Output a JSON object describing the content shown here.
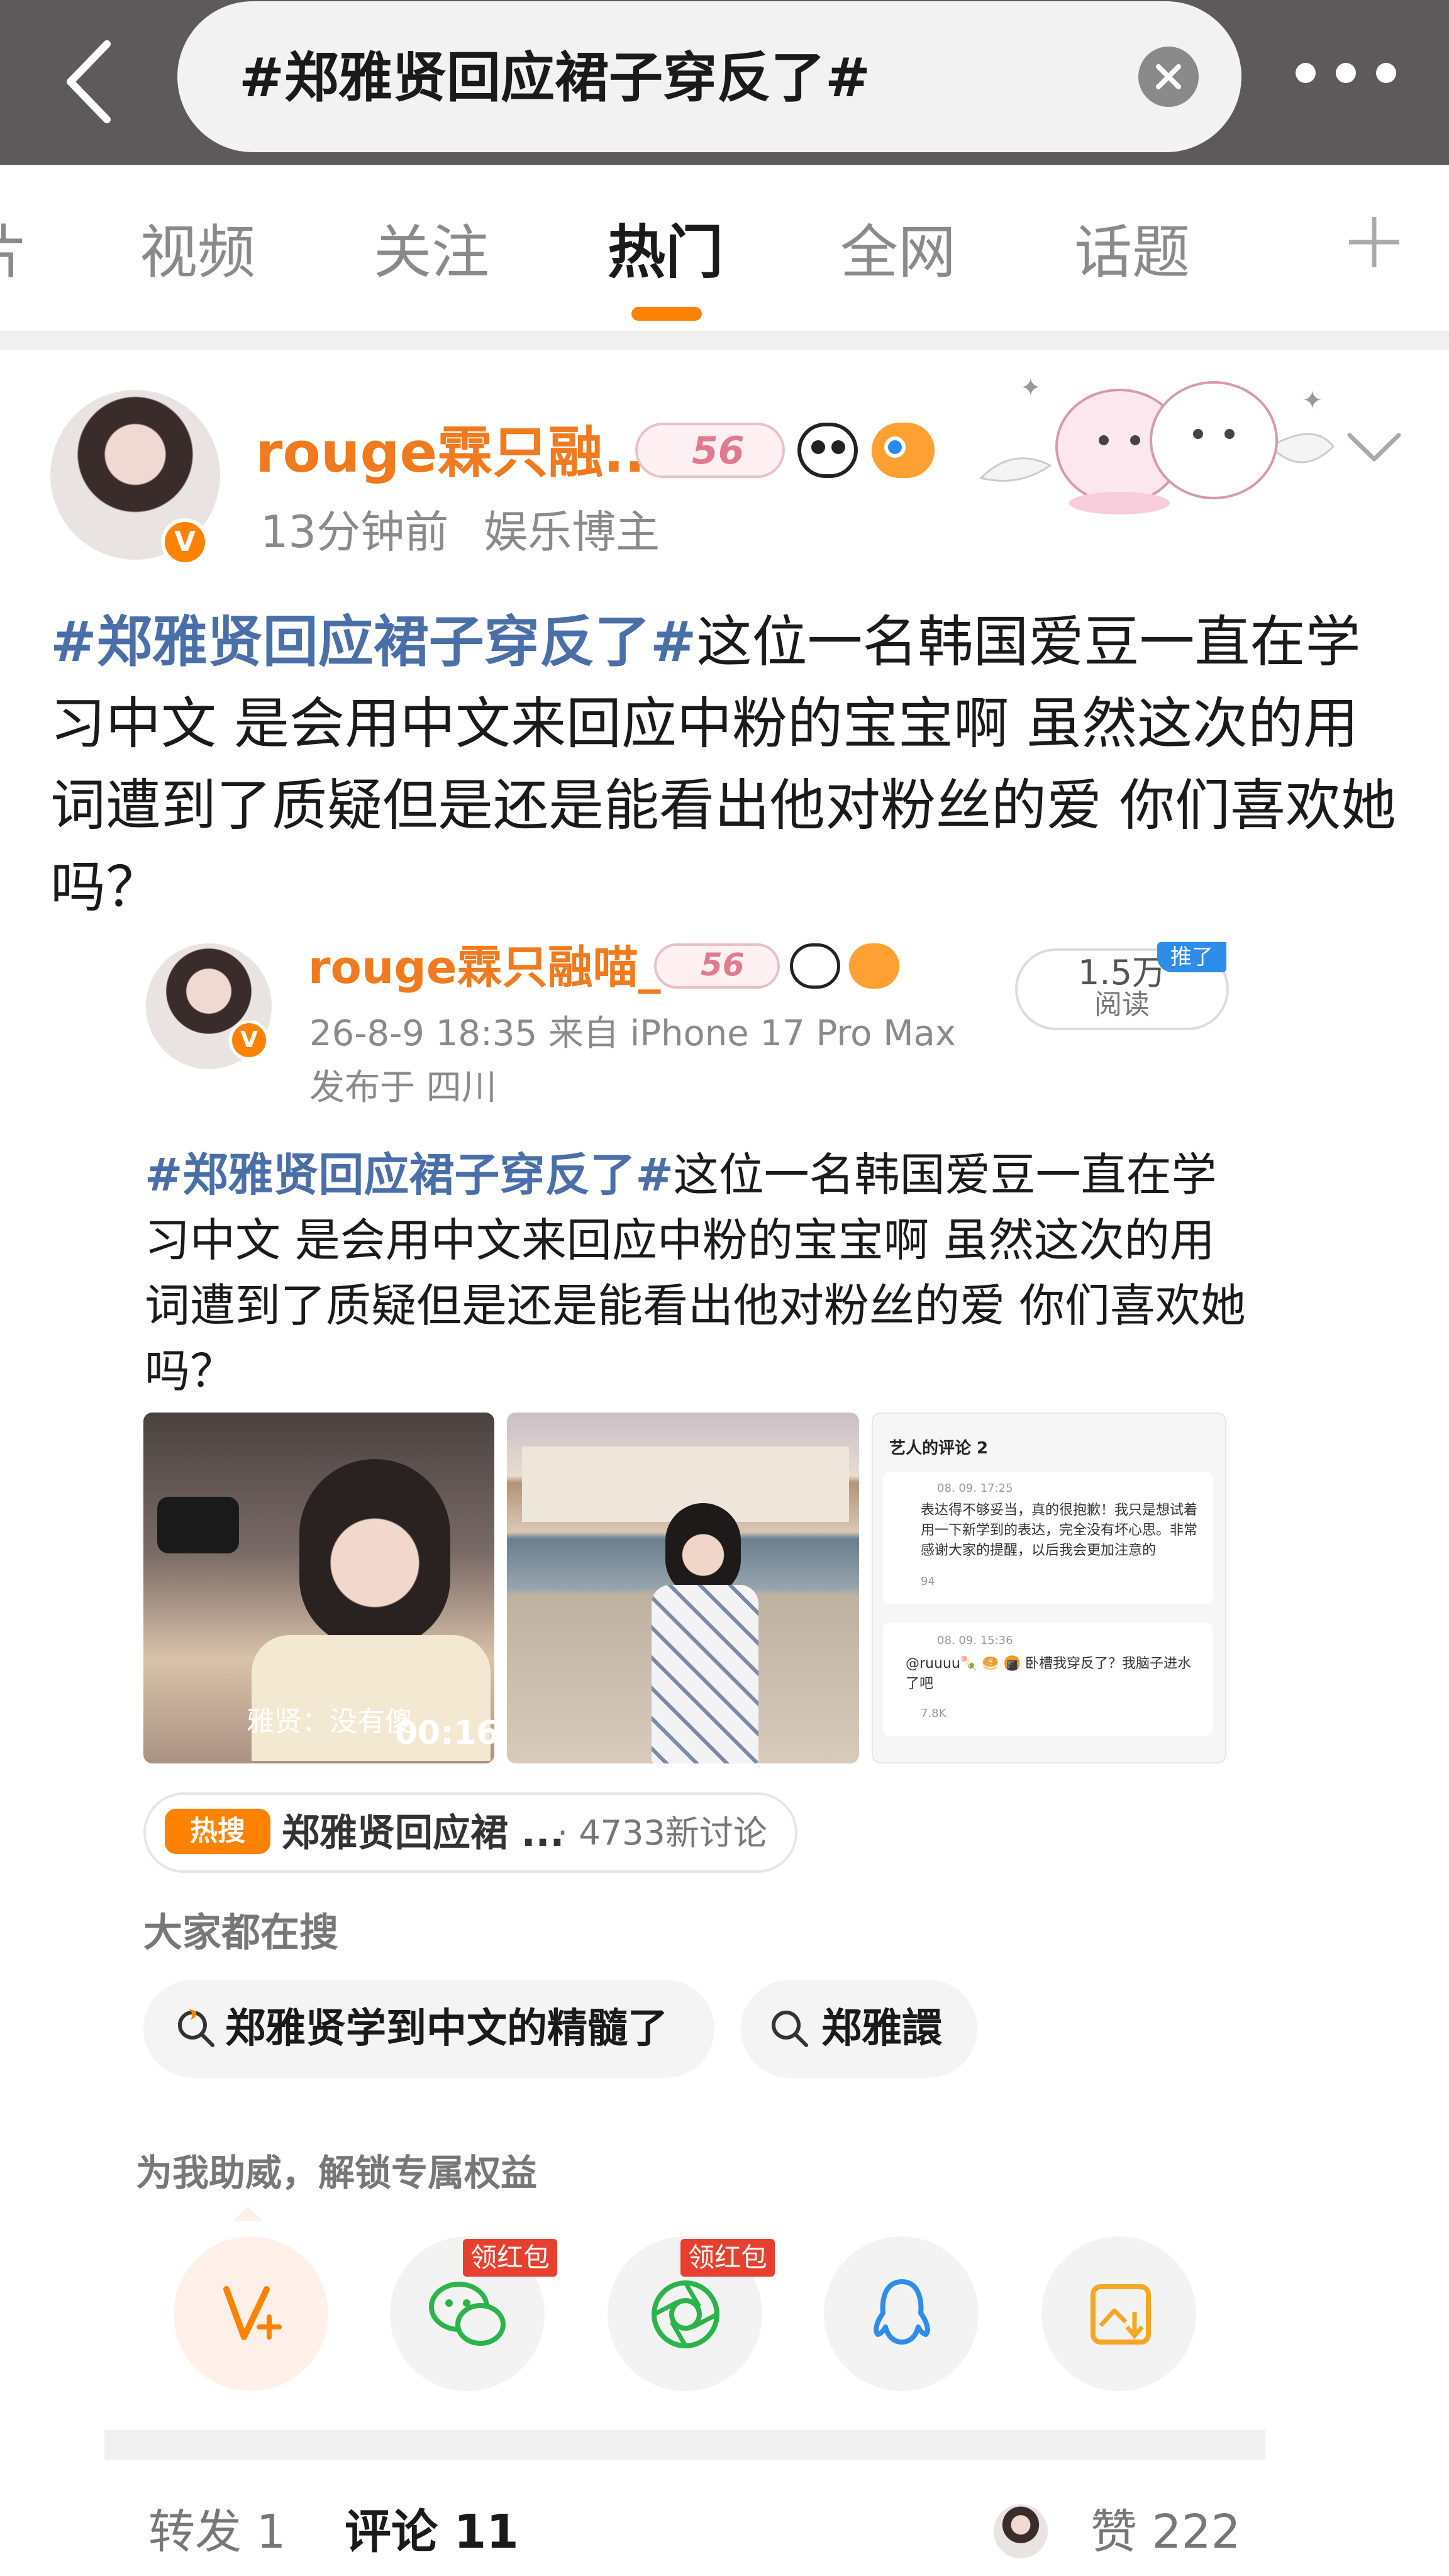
{
  "search": {
    "query": "#郑雅贤回应裙子穿反了#"
  },
  "tabs": [
    {
      "label": "片"
    },
    {
      "label": "视频"
    },
    {
      "label": "关注"
    },
    {
      "label": "热门",
      "active": true
    },
    {
      "label": "全网"
    },
    {
      "label": "话题"
    }
  ],
  "post": {
    "author": "rouge霖只融...",
    "level": "56",
    "time": "13分钟前",
    "role": "娱乐博主",
    "topic": "#郑雅贤回应裙子穿反了#",
    "text": "这位一名韩国爱豆一直在学习中文 是会用中文来回应中粉的宝宝啊 虽然这次的用词遭到了质疑但是还是能看出他对粉丝的爱 你们喜欢她吗？"
  },
  "embed": {
    "author": "rouge霖只融喵_",
    "level": "56",
    "time_source": "26-8-9 18:35  来自 iPhone 17 Pro Max",
    "location": "发布于 四川",
    "reads_count": "1.5万",
    "reads_label": "阅读",
    "reads_tag": "推了",
    "topic": "#郑雅贤回应裙子穿反了#",
    "text": "这位一名韩国爱豆一直在学习中文 是会用中文来回应中粉的宝宝啊 虽然这次的用词遭到了质疑但是还是能看出他对粉丝的爱 你们喜欢她吗？",
    "images": {
      "video_caption": "雅贤：没有傻",
      "video_duration": "00:16",
      "comments_title": "艺人的评论 2",
      "c1_date": "08. 09. 17:25",
      "c1_text_1": "表达得不够妥当，真的很抱歉！我只是想试着",
      "c1_text_2": "用一下新学到的表达，完全没有坏心思。非常",
      "c1_text_3": "感谢大家的提醒，以后我会更加注意的",
      "c1_likes": "94",
      "c2_date": "08. 09. 15:36",
      "c2_text_1": "@ruuuu🍡 🥯 🍘 卧槽我穿反了？我脑子进水",
      "c2_text_2": "了吧",
      "c2_likes": "7.8K"
    }
  },
  "hot": {
    "tag": "热搜",
    "title": "郑雅贤回应裙 ...",
    "count": "· 4733新讨论"
  },
  "searching": {
    "title": "大家都在搜",
    "q1": "郑雅贤学到中文的精髓了",
    "q2": "郑雅譞"
  },
  "share": {
    "title": "为我助威，解锁专属权益",
    "redpack1": "领红包",
    "redpack2": "领红包"
  },
  "bottom": {
    "repost": "转发 1",
    "comment": "评论 11",
    "like": "赞 222"
  },
  "colors": {
    "accent": "#ff8200",
    "topic": "#4a6fa8",
    "author": "#f07a1e",
    "topbar": "#5e5a5b"
  }
}
